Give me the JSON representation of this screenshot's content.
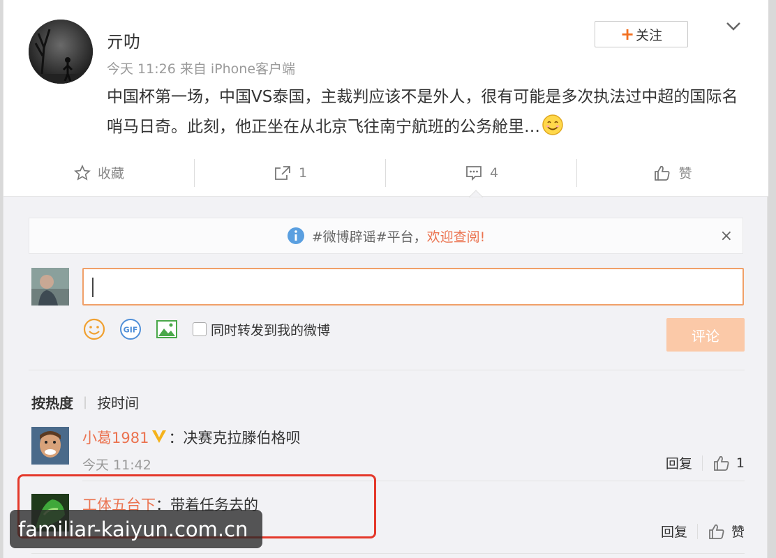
{
  "post": {
    "username": "亓叻",
    "meta": "今天 11:26 来自 iPhone客户端",
    "text": "中国杯第一场，中国VS泰国，主裁判应该不是外人，很有可能是多次执法过中超的国际名哨马日奇。此刻，他正坐在从北京飞往南宁航班的公务舱里…",
    "follow_label": "关注"
  },
  "actions": {
    "favorite": "收藏",
    "repost": "1",
    "comment": "4",
    "like": "赞"
  },
  "notice": {
    "text": "#微博辟谣#平台，",
    "link": "欢迎查阅!"
  },
  "composer": {
    "repost_label": "同时转发到我的微博",
    "submit_label": "评论"
  },
  "sort": {
    "active": "按热度",
    "other": "按时间"
  },
  "comments": [
    {
      "name": "小葛1981",
      "text": "：决赛克拉滕伯格呗",
      "time": "今天 11:42",
      "reply": "回复",
      "likes": "1"
    },
    {
      "name": "工体五台下",
      "text": "：带着任务去的",
      "reply": "回复",
      "likes": "赞"
    }
  ],
  "watermark": "familiar-kaiyun.com.cn",
  "colors": {
    "accent": "#eb7350",
    "highlight": "#e4382a",
    "submit_disabled": "#fbc9a8",
    "input_border": "#f0a068"
  }
}
